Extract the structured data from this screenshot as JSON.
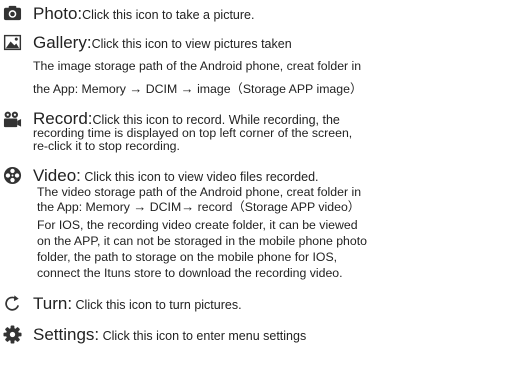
{
  "entries": {
    "photo": {
      "title": "Photo:",
      "desc": "Click this icon to take a picture."
    },
    "gallery": {
      "title": "Gallery:",
      "desc": "Click this icon to view pictures taken",
      "line1": "The image storage path of the Android phone, creat folder in",
      "path_prefix": "the App: Memory",
      "path_dcim": "DCIM",
      "path_image": "image（Storage APP image）"
    },
    "record": {
      "title": "Record:",
      "desc": "Click this icon to record. While recording, the",
      "line1": "recording time is displayed on top left corner of the screen,",
      "line2": "re-click it to stop recording."
    },
    "video": {
      "title": "Video:",
      "desc": " Click this icon to view video files recorded.",
      "line1": "The video storage path of the Android phone, creat folder in",
      "path_prefix": "the App: Memory",
      "path_dcim": "DCIM",
      "path_record": "record（Storage APP video）",
      "line3": "For IOS, the recording video create folder, it can be viewed",
      "line4": "on the APP, it can not be storaged in the mobile phone photo",
      "line5": "folder, the path to storage on the mobile phone for IOS,",
      "line6": "connect the Ituns store to download the recording video."
    },
    "turn": {
      "title": "Turn:",
      "desc": " Click this icon to turn pictures."
    },
    "settings": {
      "title": "Settings:",
      "desc": " Click this icon to enter menu settings"
    }
  },
  "arrow_glyph": "→",
  "icons": {
    "photo": "camera-icon",
    "gallery": "image-icon",
    "record": "video-camera-icon",
    "video": "film-reel-icon",
    "turn": "rotate-icon",
    "settings": "gear-icon"
  },
  "colors": {
    "text": "#222222",
    "icon": "#333333"
  }
}
